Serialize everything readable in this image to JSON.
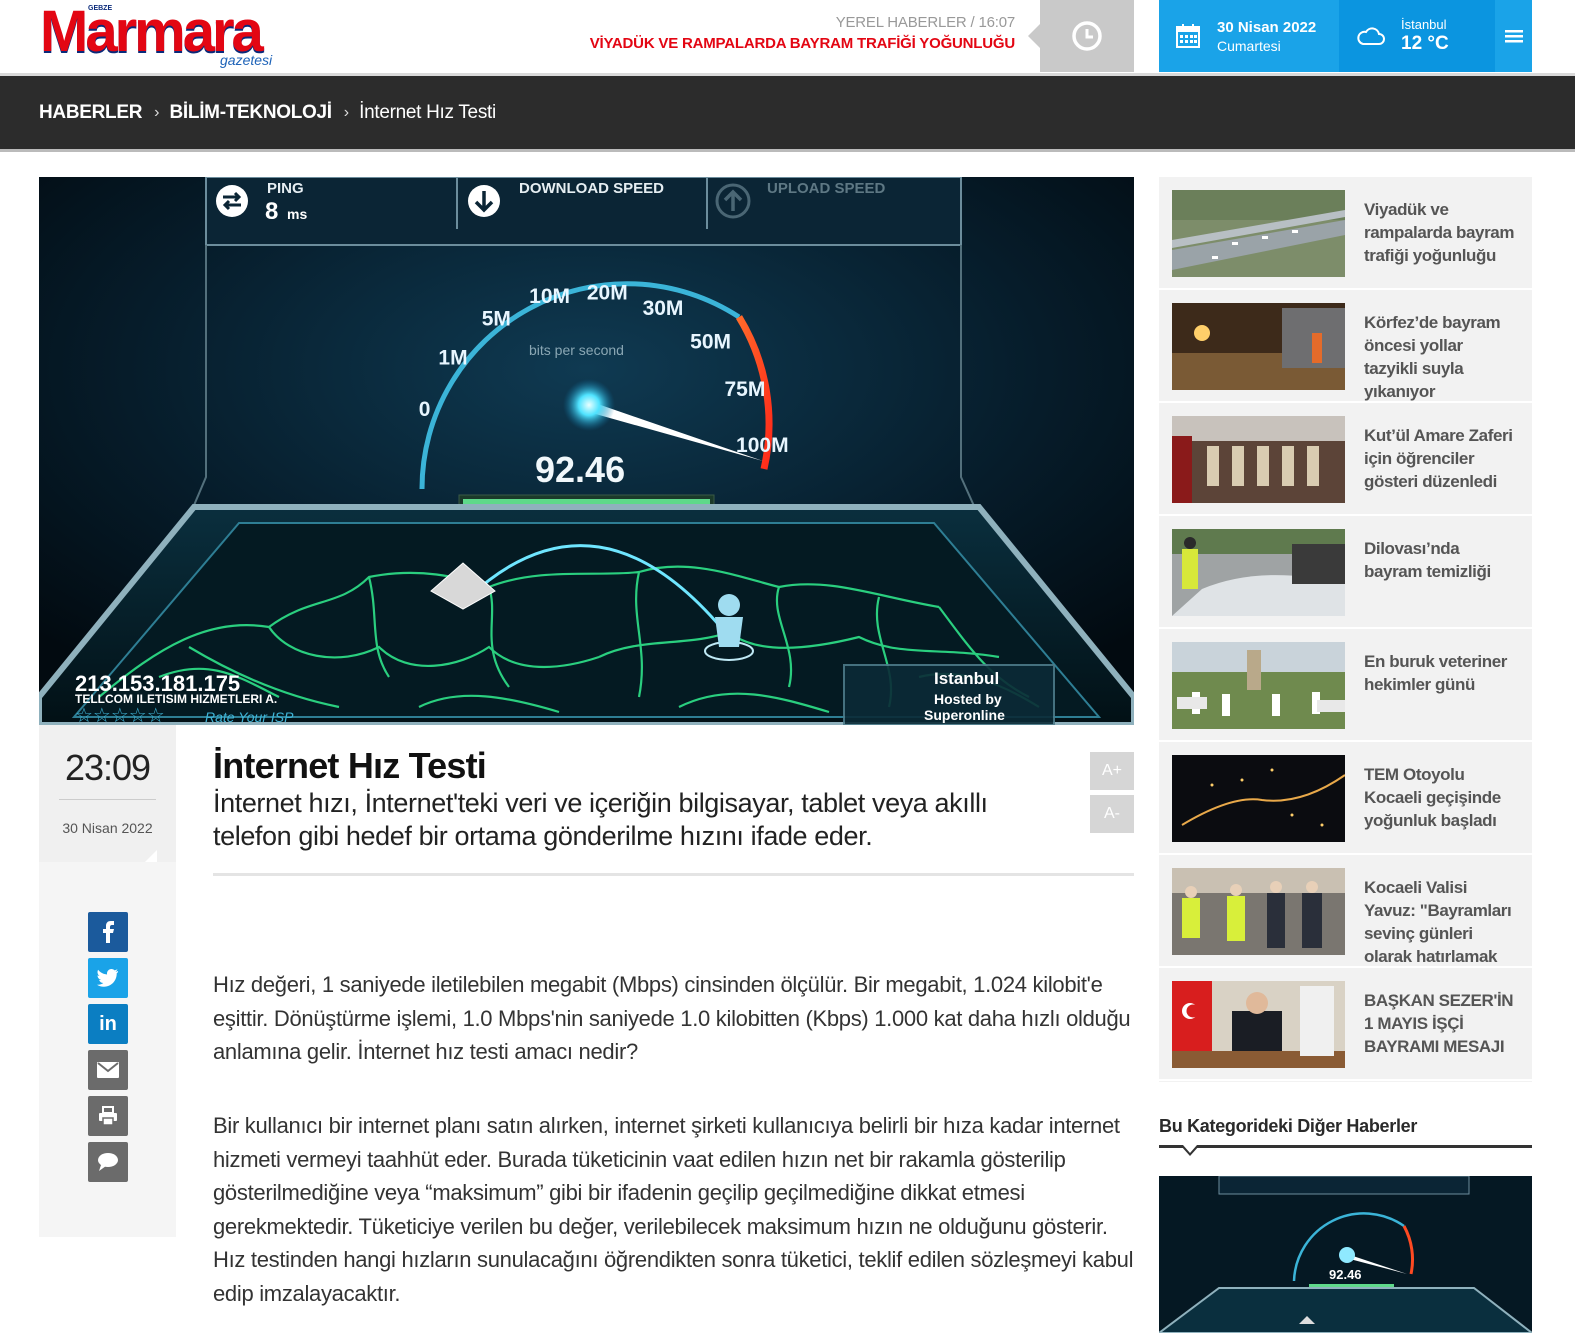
{
  "header": {
    "logo_text": "Marmara",
    "logo_prefix": "GEBZE",
    "logo_sub": "gazetesi",
    "ticker_category": "YEREL HABERLER / 16:07",
    "ticker_headline": "VİYADÜK VE RAMPALARDA BAYRAM TRAFİĞİ YOĞUNLUĞU",
    "date": "30 Nisan 2022",
    "weekday": "Cumartesi",
    "city": "İstanbul",
    "temperature": "12 °C",
    "colors": {
      "brand_red": "#e30613",
      "accent_blue": "#1aa3e8",
      "dark_bar": "#2c2c2c"
    }
  },
  "breadcrumb": [
    {
      "label": "HABERLER"
    },
    {
      "label": "BİLİM-TEKNOLOJİ"
    },
    {
      "label": "İnternet Hız Testi"
    }
  ],
  "hero": {
    "ping_label": "PING",
    "ping_value": "8",
    "ping_unit": "ms",
    "download_label": "DOWNLOAD SPEED",
    "upload_label": "UPLOAD SPEED",
    "gauge_label": "bits per second",
    "gauge_ticks": [
      "0",
      "1M",
      "5M",
      "10M",
      "20M",
      "30M",
      "50M",
      "75M",
      "100M"
    ],
    "speed_value": "92.46",
    "ip": "213.153.181.175",
    "isp": "TELLCOM ILETISIM HIZMETLERI A.",
    "rate_isp": "Rate Your ISP",
    "server_city": "Istanbul",
    "hosted_by": "Hosted by",
    "host": "Superonline"
  },
  "article": {
    "time": "23:09",
    "date": "30 Nisan 2022",
    "title": "İnternet Hız Testi",
    "spot": "İnternet hızı, İnternet'teki veri ve içeriğin bilgisayar, tablet veya akıllı telefon gibi hedef bir ortama gönderilme hızını ifade eder.",
    "font_plus": "A+",
    "font_minus": "A-",
    "paragraphs": [
      "Hız değeri, 1 saniyede iletilebilen megabit (Mbps) cinsinden ölçülür. Bir megabit, 1.024 kilobit'e eşittir. Dönüştürme işlemi, 1.0 Mbps'nin saniyede 1.0 kilobitten (Kbps) 1.000 kat daha hızlı olduğu anlamına gelir. İnternet hız testi amacı nedir?",
      "Bir kullanıcı bir internet planı satın alırken, internet şirketi kullanıcıya belirli bir hıza kadar internet hizmeti vermeyi taahhüt eder. Burada tüketicinin vaat edilen hızın net bir rakamla gösterilip gösterilmediğine veya “maksimum” gibi bir ifadenin geçilip geçilmediğine dikkat etmesi gerekmektedir. Tüketiciye verilen bu değer, verilebilecek maksimum hızın ne olduğunu gösterir. Hız testinden hangi hızların sunulacağını öğrendikten sonra tüketici, teklif edilen sözleşmeyi kabul edip imzalayacaktır."
    ]
  },
  "share_buttons": [
    {
      "icon": "facebook-icon",
      "glyph": "f",
      "color": "#1b5a9c"
    },
    {
      "icon": "twitter-icon",
      "glyph": "t",
      "color": "#1aa3e8"
    },
    {
      "icon": "linkedin-icon",
      "glyph": "in",
      "color": "#0b7ec2"
    },
    {
      "icon": "mail-icon",
      "glyph": "mail",
      "color": "#6b6b6b"
    },
    {
      "icon": "print-icon",
      "glyph": "print",
      "color": "#6b6b6b"
    },
    {
      "icon": "comment-icon",
      "glyph": "comment",
      "color": "#6b6b6b"
    }
  ],
  "sidebar": {
    "items": [
      {
        "title": "Viyadük ve rampalarda bayram trafiği yoğunluğu",
        "thumb": "highway-photo"
      },
      {
        "title": "Körfez’de bayram öncesi yollar tazyikli suyla yıkanıyor",
        "thumb": "street-washing-photo"
      },
      {
        "title": "Kut’ül Amare Zaferi için öğrenciler gösteri düzenledi",
        "thumb": "stage-performance-photo"
      },
      {
        "title": "Dilovası’nda bayram temizliği",
        "thumb": "cleaning-photo"
      },
      {
        "title": "En buruk veteriner hekimler günü",
        "thumb": "ceremony-photo"
      },
      {
        "title": "TEM Otoyolu Kocaeli geçişinde yoğunluk başladı",
        "thumb": "night-traffic-photo"
      },
      {
        "title": "Kocaeli Valisi Yavuz: \"Bayramları sevinç günleri olarak hatırlamak ve",
        "thumb": "police-officials-photo"
      },
      {
        "title": "BAŞKAN SEZER'İN 1 MAYIS İŞÇİ BAYRAMI MESAJI",
        "thumb": "mayor-office-photo"
      }
    ],
    "category_title": "Bu Kategorideki Diğer Haberler"
  }
}
